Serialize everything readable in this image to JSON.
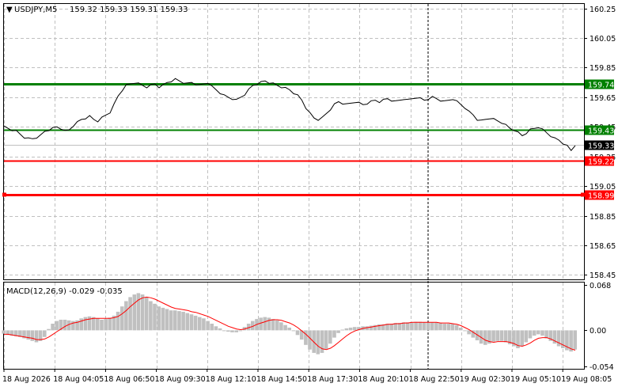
{
  "header": {
    "symbol": "USDJPY,M5",
    "ohlc": "159.32 159.33 159.31 159.33"
  },
  "macd": {
    "label": "MACD(12,26,9) -0.029 -0.035",
    "scale_labels": [
      "0.068",
      "0.00",
      "-0.054"
    ]
  },
  "colors": {
    "grid": "#c0c0c0",
    "price_line": "#000000",
    "resistance": "#008000",
    "support": "#ff0000",
    "macd_hist": "#c0c0c0",
    "macd_signal": "#ff0000",
    "current_price_bg": "#000000"
  },
  "levels": [
    {
      "name": "resistance-1",
      "value": 159.74,
      "label": "159.74",
      "color": "#008000",
      "width": 3
    },
    {
      "name": "resistance-2",
      "value": 159.43,
      "label": "159.43",
      "color": "#008000",
      "width": 2
    },
    {
      "name": "support-1",
      "value": 159.22,
      "label": "159.22",
      "color": "#ff0000",
      "width": 2
    },
    {
      "name": "support-2",
      "value": 158.99,
      "label": "158.99",
      "color": "#ff0000",
      "width": 3
    }
  ],
  "current_price": {
    "value": 159.33,
    "label": "159.33"
  },
  "chart_data": [
    {
      "type": "line",
      "title": "USDJPY,M5",
      "y_tick_labels": [
        "160.25",
        "160.05",
        "159.85",
        "159.65",
        "159.45",
        "159.25",
        "159.05",
        "158.85",
        "158.65",
        "158.45"
      ],
      "ylim": [
        158.42,
        160.28
      ],
      "x_tick_labels": [
        "18 Aug 2026",
        "18 Aug 04:05",
        "18 Aug 06:50",
        "18 Aug 09:30",
        "18 Aug 12:10",
        "18 Aug 14:50",
        "18 Aug 17:30",
        "18 Aug 20:10",
        "18 Aug 22:50",
        "19 Aug 02:30",
        "19 Aug 05:10",
        "19 Aug 08:05"
      ],
      "values": [
        159.45,
        159.44,
        159.43,
        159.42,
        159.4,
        159.38,
        159.37,
        159.37,
        159.38,
        159.39,
        159.42,
        159.43,
        159.44,
        159.45,
        159.44,
        159.42,
        159.43,
        159.46,
        159.48,
        159.5,
        159.51,
        159.52,
        159.5,
        159.49,
        159.51,
        159.53,
        159.55,
        159.6,
        159.66,
        159.7,
        159.73,
        159.74,
        159.75,
        159.74,
        159.73,
        159.72,
        159.73,
        159.74,
        159.72,
        159.73,
        159.75,
        159.76,
        159.77,
        159.76,
        159.75,
        159.74,
        159.75,
        159.74,
        159.73,
        159.74,
        159.75,
        159.72,
        159.7,
        159.68,
        159.66,
        159.65,
        159.64,
        159.63,
        159.65,
        159.67,
        159.7,
        159.73,
        159.74,
        159.75,
        159.76,
        159.75,
        159.74,
        159.73,
        159.72,
        159.71,
        159.7,
        159.68,
        159.66,
        159.63,
        159.58,
        159.54,
        159.51,
        159.5,
        159.51,
        159.54,
        159.57,
        159.6,
        159.62,
        159.61,
        159.6,
        159.61,
        159.62,
        159.61,
        159.6,
        159.61,
        159.62,
        159.63,
        159.62,
        159.63,
        159.64,
        159.63,
        159.62,
        159.63,
        159.64,
        159.63,
        159.64,
        159.65,
        159.64,
        159.63,
        159.64,
        159.65,
        159.64,
        159.63,
        159.62,
        159.63,
        159.64,
        159.62,
        159.6,
        159.58,
        159.55,
        159.53,
        159.5,
        159.49,
        159.5,
        159.51,
        159.5,
        159.49,
        159.48,
        159.46,
        159.44,
        159.43,
        159.41,
        159.39,
        159.41,
        159.43,
        159.44,
        159.45,
        159.43,
        159.41,
        159.39,
        159.37,
        159.36,
        159.34,
        159.32,
        159.29,
        159.33
      ],
      "series": [
        {
          "name": "USDJPY,M5",
          "values": []
        }
      ]
    },
    {
      "type": "bar",
      "title": "MACD(12,26,9) -0.029 -0.035",
      "ylim": [
        -0.058,
        0.072
      ],
      "y_tick_labels": [
        "0.068",
        "0.00",
        "-0.054"
      ],
      "histogram": [
        -0.005,
        -0.007,
        -0.008,
        -0.009,
        -0.01,
        -0.012,
        -0.014,
        -0.016,
        -0.018,
        -0.016,
        -0.01,
        0.002,
        0.01,
        0.014,
        0.016,
        0.016,
        0.015,
        0.014,
        0.015,
        0.018,
        0.02,
        0.021,
        0.02,
        0.018,
        0.016,
        0.017,
        0.019,
        0.022,
        0.028,
        0.036,
        0.044,
        0.05,
        0.054,
        0.056,
        0.054,
        0.05,
        0.044,
        0.04,
        0.036,
        0.034,
        0.032,
        0.03,
        0.03,
        0.029,
        0.028,
        0.026,
        0.024,
        0.022,
        0.02,
        0.018,
        0.014,
        0.01,
        0.006,
        0.003,
        0.0,
        -0.002,
        -0.003,
        -0.003,
        0.0,
        0.005,
        0.01,
        0.014,
        0.017,
        0.019,
        0.02,
        0.019,
        0.017,
        0.015,
        0.012,
        0.008,
        0.004,
        -0.001,
        -0.007,
        -0.014,
        -0.022,
        -0.029,
        -0.034,
        -0.036,
        -0.034,
        -0.028,
        -0.02,
        -0.011,
        -0.004,
        0.001,
        0.003,
        0.004,
        0.005,
        0.005,
        0.006,
        0.006,
        0.007,
        0.008,
        0.009,
        0.009,
        0.01,
        0.01,
        0.011,
        0.011,
        0.012,
        0.012,
        0.012,
        0.013,
        0.013,
        0.012,
        0.012,
        0.012,
        0.012,
        0.011,
        0.01,
        0.01,
        0.01,
        0.008,
        0.004,
        -0.001,
        -0.006,
        -0.011,
        -0.015,
        -0.02,
        -0.022,
        -0.02,
        -0.017,
        -0.016,
        -0.016,
        -0.018,
        -0.021,
        -0.024,
        -0.027,
        -0.024,
        -0.018,
        -0.012,
        -0.008,
        -0.006,
        -0.008,
        -0.012,
        -0.016,
        -0.02,
        -0.024,
        -0.027,
        -0.03,
        -0.032,
        -0.029
      ],
      "signal": [
        -0.006,
        -0.006,
        -0.007,
        -0.008,
        -0.009,
        -0.01,
        -0.011,
        -0.012,
        -0.014,
        -0.014,
        -0.013,
        -0.01,
        -0.006,
        -0.002,
        0.002,
        0.006,
        0.009,
        0.011,
        0.012,
        0.014,
        0.016,
        0.017,
        0.018,
        0.018,
        0.018,
        0.018,
        0.018,
        0.019,
        0.021,
        0.025,
        0.03,
        0.036,
        0.041,
        0.046,
        0.049,
        0.05,
        0.049,
        0.047,
        0.044,
        0.041,
        0.038,
        0.035,
        0.033,
        0.032,
        0.031,
        0.03,
        0.028,
        0.027,
        0.025,
        0.023,
        0.021,
        0.018,
        0.015,
        0.012,
        0.009,
        0.006,
        0.004,
        0.002,
        0.001,
        0.002,
        0.004,
        0.006,
        0.009,
        0.011,
        0.013,
        0.015,
        0.016,
        0.016,
        0.015,
        0.013,
        0.011,
        0.008,
        0.004,
        -0.001,
        -0.006,
        -0.012,
        -0.018,
        -0.024,
        -0.028,
        -0.029,
        -0.027,
        -0.023,
        -0.018,
        -0.013,
        -0.008,
        -0.004,
        -0.001,
        0.001,
        0.003,
        0.004,
        0.005,
        0.006,
        0.007,
        0.008,
        0.009,
        0.009,
        0.01,
        0.01,
        0.011,
        0.011,
        0.012,
        0.012,
        0.012,
        0.012,
        0.012,
        0.012,
        0.012,
        0.011,
        0.011,
        0.011,
        0.01,
        0.009,
        0.007,
        0.004,
        0.001,
        -0.003,
        -0.007,
        -0.011,
        -0.015,
        -0.017,
        -0.018,
        -0.017,
        -0.017,
        -0.017,
        -0.018,
        -0.02,
        -0.023,
        -0.024,
        -0.022,
        -0.019,
        -0.015,
        -0.012,
        -0.011,
        -0.011,
        -0.013,
        -0.016,
        -0.019,
        -0.022,
        -0.025,
        -0.028,
        -0.03
      ]
    }
  ]
}
